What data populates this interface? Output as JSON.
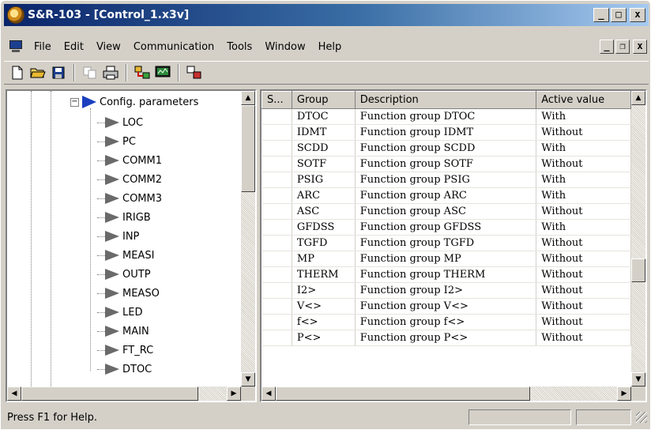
{
  "window": {
    "title": "S&R-103 - [Control_1.x3v]"
  },
  "menu": [
    "File",
    "Edit",
    "View",
    "Communication",
    "Tools",
    "Window",
    "Help"
  ],
  "tree": {
    "root": "Config. parameters",
    "items": [
      "LOC",
      "PC",
      "COMM1",
      "COMM2",
      "COMM3",
      "IRIGB",
      "INP",
      "MEASI",
      "OUTP",
      "MEASO",
      "LED",
      "MAIN",
      "FT_RC",
      "DTOC"
    ]
  },
  "table": {
    "columns": [
      "S...",
      "Group",
      "Description",
      "Active value"
    ],
    "rows": [
      [
        "",
        "DTOC",
        "Function group DTOC",
        "With"
      ],
      [
        "",
        "IDMT",
        "Function group IDMT",
        "Without"
      ],
      [
        "",
        "SCDD",
        "Function group SCDD",
        "With"
      ],
      [
        "",
        "SOTF",
        "Function group SOTF",
        "Without"
      ],
      [
        "",
        "PSIG",
        "Function group PSIG",
        "With"
      ],
      [
        "",
        "ARC",
        "Function group ARC",
        "With"
      ],
      [
        "",
        "ASC",
        "Function group ASC",
        "Without"
      ],
      [
        "",
        "GFDSS",
        "Function group GFDSS",
        "With"
      ],
      [
        "",
        "TGFD",
        "Function group TGFD",
        "Without"
      ],
      [
        "",
        "MP",
        "Function group MP",
        "Without"
      ],
      [
        "",
        "THERM",
        "Function group THERM",
        "Without"
      ],
      [
        "",
        "I2>",
        "Function group I2>",
        "Without"
      ],
      [
        "",
        "V<>",
        "Function group V<>",
        "Without"
      ],
      [
        "",
        "f<>",
        "Function group f<>",
        "Without"
      ],
      [
        "",
        "P<>",
        "Function group P<>",
        "Without"
      ]
    ]
  },
  "status": {
    "text": "Press F1 for Help."
  },
  "icons": {
    "toolbar": [
      "new-file-icon",
      "open-folder-icon",
      "save-icon",
      "copy-icon",
      "print-icon",
      "device-connect-icon",
      "monitor-icon",
      "transfer-icon"
    ]
  }
}
